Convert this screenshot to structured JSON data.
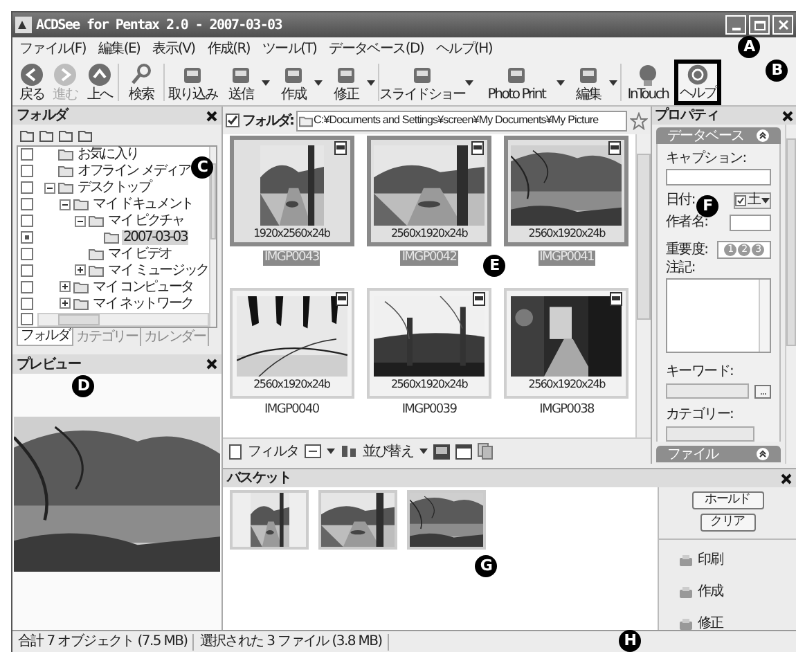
{
  "window": {
    "title": "ACDSee for Pentax 2.0  - 2007-03-03"
  },
  "menu": [
    "ファイル(F)",
    "編集(E)",
    "表示(V)",
    "作成(R)",
    "ツール(T)",
    "データベース(D)",
    "ヘルプ(H)"
  ],
  "toolbar": [
    {
      "label": "戻る",
      "disabled": false,
      "dropdown": false,
      "highlighted": false
    },
    {
      "label": "進む",
      "disabled": true,
      "dropdown": false,
      "highlighted": false
    },
    {
      "label": "上へ",
      "disabled": false,
      "dropdown": false,
      "highlighted": false
    },
    {
      "label": "検索",
      "disabled": false,
      "dropdown": false,
      "highlighted": false
    },
    {
      "label": "取り込み",
      "disabled": false,
      "dropdown": false,
      "highlighted": false
    },
    {
      "label": "送信",
      "disabled": false,
      "dropdown": true,
      "highlighted": false
    },
    {
      "label": "作成",
      "disabled": false,
      "dropdown": true,
      "highlighted": false
    },
    {
      "label": "修正",
      "disabled": false,
      "dropdown": true,
      "highlighted": false
    },
    {
      "label": "スライドショー",
      "disabled": false,
      "dropdown": true,
      "highlighted": false
    },
    {
      "label": "Photo Print",
      "disabled": false,
      "dropdown": true,
      "highlighted": false
    },
    {
      "label": "編集",
      "disabled": false,
      "dropdown": true,
      "highlighted": false
    },
    {
      "label": "InTouch",
      "disabled": false,
      "dropdown": false,
      "highlighted": false
    },
    {
      "label": "ヘルプ",
      "disabled": false,
      "dropdown": false,
      "highlighted": true
    }
  ],
  "folder_panel": {
    "title": "フォルダ",
    "tree": [
      {
        "label": "お気に入り",
        "checked": false,
        "selected": false
      },
      {
        "label": "オフライン メディア",
        "checked": false,
        "selected": false
      },
      {
        "label": "デスクトップ",
        "checked": false,
        "selected": false,
        "expanded": true,
        "children": [
          {
            "label": "マイ ドキュメント",
            "checked": false,
            "selected": false,
            "expanded": true,
            "children": [
              {
                "label": "マイ ピクチャ",
                "checked": false,
                "selected": false,
                "expanded": true,
                "children": [
                  {
                    "label": "2007-03-03",
                    "checked": true,
                    "selected": true
                  }
                ]
              },
              {
                "label": "マイ ビデオ",
                "checked": false,
                "selected": false
              },
              {
                "label": "マイ ミュージック",
                "checked": false,
                "selected": false,
                "expanded": false
              }
            ]
          },
          {
            "label": "マイ コンピュータ",
            "checked": false,
            "selected": false,
            "expanded": false
          },
          {
            "label": "マイ ネットワーク",
            "checked": false,
            "selected": false,
            "expanded": false
          }
        ]
      }
    ],
    "footer_checkbox": {
      "checked": false
    },
    "tabs": [
      {
        "label": "フォルダ",
        "selected": true
      },
      {
        "label": "カテゴリー",
        "selected": false
      },
      {
        "label": "カレンダー",
        "selected": false
      }
    ]
  },
  "preview_panel": {
    "title": "プレビュー"
  },
  "browser": {
    "folder_bar": {
      "checked": true,
      "label": "フォルダ:",
      "path": "C:¥Documents and Settings¥screen¥My Documents¥My Picture"
    },
    "thumbnails": [
      {
        "dimensions": "1920x2560x24b",
        "name": "IMGP0043",
        "selected": true
      },
      {
        "dimensions": "2560x1920x24b",
        "name": "IMGP0042",
        "selected": true
      },
      {
        "dimensions": "2560x1920x24b",
        "name": "IMGP0041",
        "selected": true
      },
      {
        "dimensions": "2560x1920x24b",
        "name": "IMGP0040",
        "selected": false
      },
      {
        "dimensions": "2560x1920x24b",
        "name": "IMGP0039",
        "selected": false
      },
      {
        "dimensions": "2560x1920x24b",
        "name": "IMGP0038",
        "selected": false
      }
    ],
    "bottom_toolbar": [
      "フィルタ",
      "並び替え"
    ]
  },
  "properties_panel": {
    "title": "プロパティ",
    "section": "データベース",
    "caption_label": "キャプション:",
    "date_label": "日付:",
    "date": {
      "checked": true,
      "value": "土"
    },
    "author_label": "作者名:",
    "importance_label": "重要度:",
    "rating_buttons": [
      "1",
      "2",
      "3"
    ],
    "notes_label": "注記:",
    "keyword_label": "キーワード:",
    "keyword_button": "...",
    "category_label": "カテゴリー:",
    "next_section": "ファイル"
  },
  "basket": {
    "title": "バスケット",
    "buttons": [
      "ホールド",
      "クリア"
    ],
    "actions": [
      "印刷",
      "作成",
      "修正"
    ]
  },
  "status_bar": [
    "合計 7 オブジェクト (7.5 MB)",
    "選択された 3 ファイル (3.8 MB)"
  ],
  "callouts": [
    "A",
    "B",
    "C",
    "D",
    "E",
    "F",
    "G",
    "H"
  ]
}
